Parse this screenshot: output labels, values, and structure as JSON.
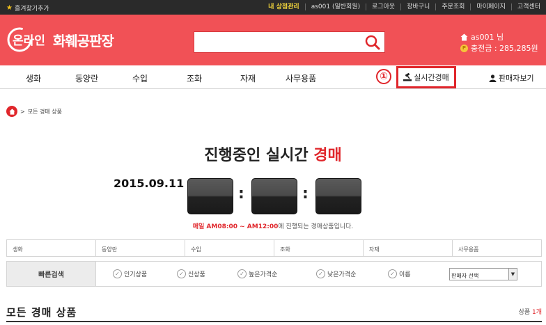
{
  "topbar": {
    "favorite": "즐겨찾기추가",
    "links": [
      "내 상점관리",
      "as001 (일반회원)",
      "로그아웃",
      "장바구니",
      "주문조회",
      "마이페이지",
      "고객센터"
    ]
  },
  "header": {
    "logo_text": "화훼공판장",
    "logo_prefix": "온라인",
    "search": {
      "value": "",
      "placeholder": ""
    },
    "user_line": "as001 님",
    "points_line": "충전금 : 285,285원"
  },
  "nav": {
    "items": [
      "생화",
      "동양란",
      "수입",
      "조화",
      "자재",
      "사무용품"
    ],
    "live_auction": "실시간경매",
    "badge": "①",
    "seller_view": "판매자보기"
  },
  "breadcrumb": {
    "sep": ">",
    "label": "모든 경매 상품"
  },
  "title": {
    "main": "진행중인 실시간 ",
    "accent": "경매"
  },
  "date": "2015.09.11",
  "notice": {
    "red": "매일 AM08:00 ~ AM12:00",
    "rest": "에 진행되는 경매상품입니다."
  },
  "categories": [
    "생화",
    "동양란",
    "수입",
    "조화",
    "자재",
    "사무용품"
  ],
  "quick": {
    "label": "빠른검색",
    "options": [
      "인기상품",
      "신상품",
      "높은가격순",
      "낮은가격순",
      "이름"
    ],
    "select_value": "판매자 선택"
  },
  "section": {
    "title": "모든 경매 상품",
    "count_label": "상품 ",
    "count_value": "1개"
  },
  "colors": {
    "brand": "#f15156",
    "accent": "#e0262b",
    "topbar": "#2a2a2a"
  }
}
